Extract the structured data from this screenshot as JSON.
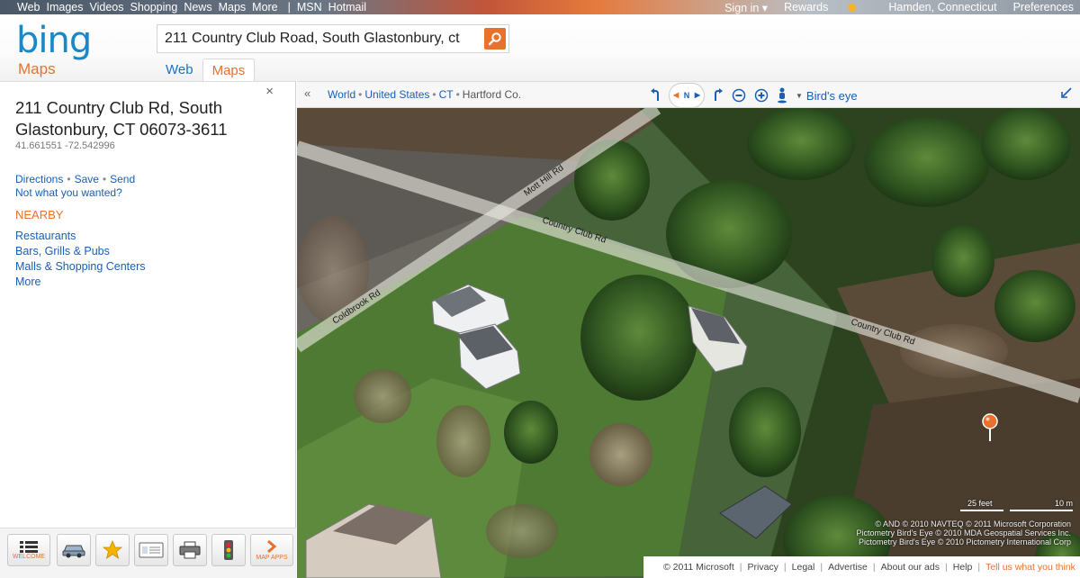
{
  "topnav": {
    "items": [
      "Web",
      "Images",
      "Videos",
      "Shopping",
      "News",
      "Maps",
      "More"
    ],
    "after_sep": [
      "MSN",
      "Hotmail"
    ],
    "separator": "|",
    "sign_in": "Sign in ▾",
    "rewards": "Rewards",
    "location": "Hamden, Connecticut",
    "preferences": "Preferences"
  },
  "brand": {
    "logo": "bing",
    "product": "Maps",
    "logo_color": "#1a87c8",
    "accent": "#e8712c"
  },
  "search": {
    "value": "211 Country Club Road, South Glastonbury, ct",
    "button_icon": "search-icon"
  },
  "tabs": [
    {
      "label": "Web"
    },
    {
      "label": "Maps"
    }
  ],
  "result": {
    "close": "×",
    "address": "211 Country Club Rd, South Glastonbury, CT 06073-3611",
    "coords": "41.661551 -72.542996",
    "actions": [
      "Directions",
      "Save",
      "Send"
    ],
    "action_sep": "•",
    "not_what": "Not what you wanted?",
    "nearby_title": "NEARBY",
    "nearby": [
      "Restaurants",
      "Bars, Grills & Pubs",
      "Malls & Shopping Centers",
      "More"
    ]
  },
  "toolbar": {
    "welcome_label": "WELCOME",
    "map_apps_label": "MAP APPS",
    "icons": [
      "list-icon",
      "car-icon",
      "star-icon",
      "card-icon",
      "printer-icon",
      "traffic-light-icon",
      "chevron-right-icon"
    ]
  },
  "map_toolbar": {
    "collapse": "«",
    "breadcrumb": [
      "World",
      "United States",
      "CT",
      "Hartford Co."
    ],
    "crumb_sep": "•",
    "compass": "N",
    "view_mode": "Bird's eye"
  },
  "map": {
    "roads": [
      "Mott Hill Rd",
      "Country Club Rd",
      "Coldbrook Rd",
      "Country Club Rd"
    ],
    "scale_feet": "25 feet",
    "scale_m": "10 m",
    "attribution": [
      "© AND   © 2010 NAVTEQ   © 2011 Microsoft Corporation",
      "Pictometry Bird's Eye © 2010 MDA Geospatial Services Inc.",
      "Pictometry Bird's Eye © 2010 Pictometry International Corp"
    ]
  },
  "footer": {
    "copyright": "© 2011 Microsoft",
    "links": [
      "Privacy",
      "Legal",
      "Advertise",
      "About our ads",
      "Help"
    ],
    "tell": "Tell us what you think"
  }
}
